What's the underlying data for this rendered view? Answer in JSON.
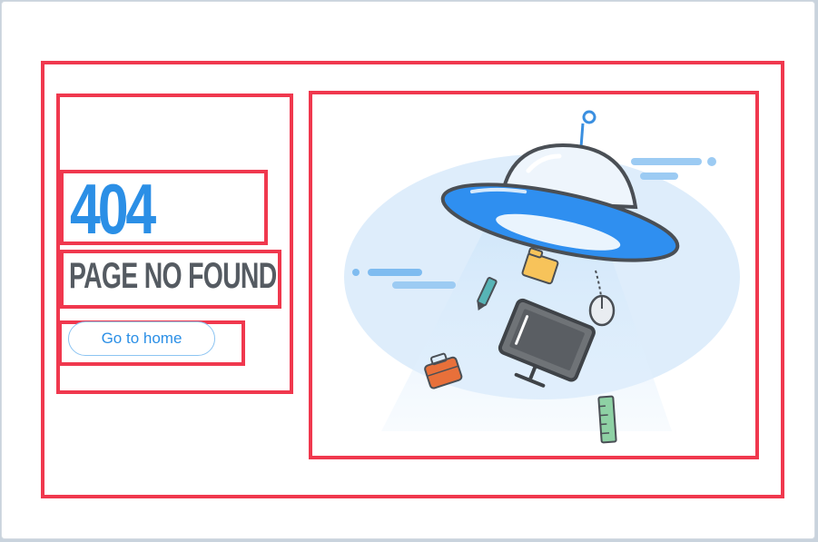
{
  "error": {
    "code": "404",
    "message": "PAGE NO FOUND"
  },
  "actions": {
    "home_label": "Go to home"
  },
  "colors": {
    "accent": "#2b8fe6",
    "highlight_border": "#f0384e",
    "heading_text": "#555b62"
  },
  "illustration": {
    "icon": "ufo-icon"
  }
}
